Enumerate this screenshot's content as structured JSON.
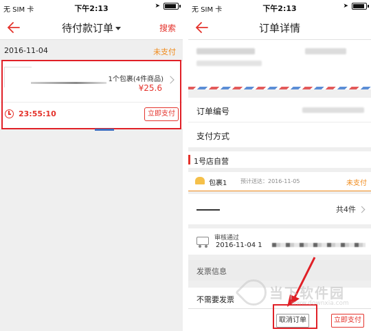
{
  "statusbar": {
    "carrier": "无 SIM 卡",
    "time": "下午2:13"
  },
  "left_screen": {
    "nav": {
      "title": "待付款订单",
      "search": "搜索"
    },
    "order": {
      "date": "2016-11-04",
      "status": "未支付",
      "package_summary": "1个包裹(4件商品)",
      "price": "¥25.6",
      "countdown": "23:55:10",
      "pay_button": "立即支付"
    }
  },
  "right_screen": {
    "nav": {
      "title": "订单详情"
    },
    "rows": {
      "order_no_label": "订单编号",
      "payment_label": "支付方式"
    },
    "store": {
      "name": "1号店自营"
    },
    "package": {
      "name": "包裹1",
      "eta": "预计送达：2016-11-05",
      "status": "未支付"
    },
    "goods": {
      "count": "共4件"
    },
    "tracking": {
      "title": "审核通过",
      "date": "2016-11-04 1"
    },
    "invoice_section": "发票信息",
    "invoice_value": "不需要发票",
    "buttons": {
      "cancel": "取消订单",
      "pay": "立即支付"
    }
  },
  "watermark": {
    "name": "当下软件园",
    "url": "www.downxia.com"
  },
  "colors": {
    "accent_red": "#e4322b",
    "status_orange": "#f08a1a",
    "highlight": "#e01f26"
  }
}
